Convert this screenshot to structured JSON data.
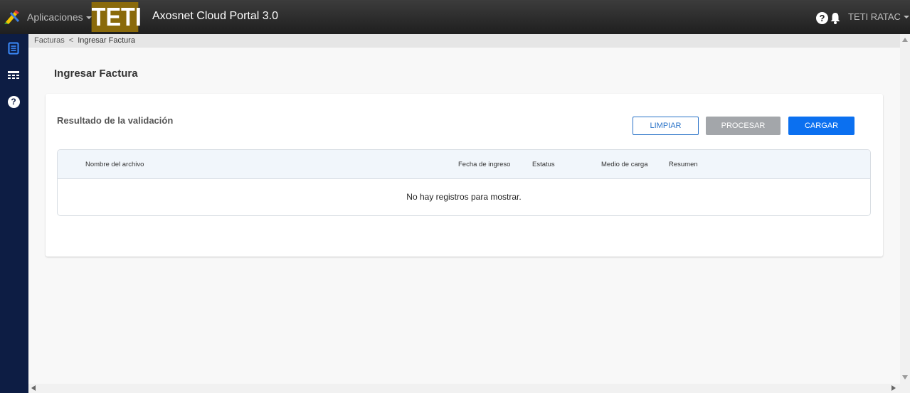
{
  "header": {
    "apps_menu_label": "Aplicaciones",
    "brand_logo_text": "TETI",
    "portal_title": "Axosnet Cloud Portal 3.0",
    "help_icon_glyph": "?",
    "user_menu_label": "TETI RATAC"
  },
  "sidebar": {
    "items": [
      {
        "icon": "document-icon"
      },
      {
        "icon": "table-icon"
      },
      {
        "icon": "help-icon",
        "glyph": "?"
      }
    ]
  },
  "breadcrumb": {
    "parent": "Facturas",
    "separator": "<",
    "current": "Ingresar Factura"
  },
  "page": {
    "title": "Ingresar Factura"
  },
  "card": {
    "title": "Resultado de la validación",
    "buttons": {
      "clear": "LIMPIAR",
      "process": "PROCESAR",
      "load": "CARGAR"
    }
  },
  "table": {
    "columns": [
      "Nombre del archivo",
      "Fecha de ingreso",
      "Estatus",
      "Medio de carga",
      "Resumen"
    ],
    "empty_message": "No hay registros para mostrar."
  },
  "colors": {
    "topbar": "#2a2a2a",
    "sidebar": "#0d1d44",
    "brand": "#8a6a0b",
    "primary": "#0b70f0",
    "disabled": "#a3a6aa"
  }
}
